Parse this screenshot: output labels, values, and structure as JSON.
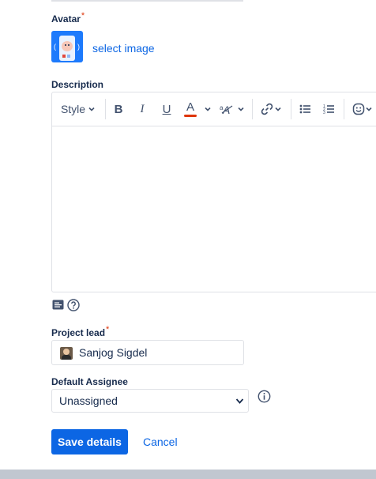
{
  "avatar": {
    "label": "Avatar",
    "required_mark": "*",
    "select_link": "select image"
  },
  "description": {
    "label": "Description",
    "toolbar": {
      "style_label": "Style",
      "bold": "B",
      "italic": "I",
      "underline": "U",
      "text_color": "A",
      "text_color_accent": "#de350b"
    }
  },
  "project_lead": {
    "label": "Project lead",
    "required_mark": "*",
    "value": "Sanjog Sigdel"
  },
  "default_assignee": {
    "label": "Default Assignee",
    "value": "Unassigned",
    "options": [
      "Unassigned"
    ]
  },
  "actions": {
    "save_label": "Save details",
    "cancel_label": "Cancel"
  },
  "colors": {
    "primary": "#0c66e4",
    "text": "#172b4d",
    "required": "#de350b",
    "border": "#dfe1e6"
  }
}
